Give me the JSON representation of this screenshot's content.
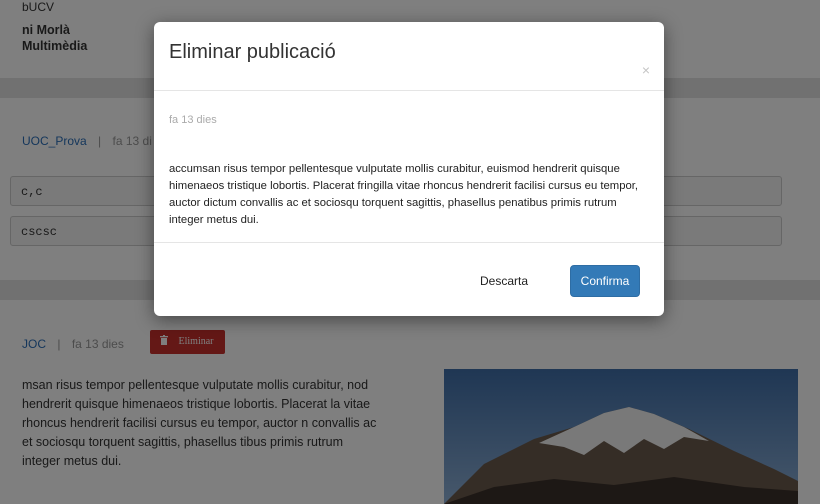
{
  "background": {
    "top_fragment": "bUCV",
    "author_name": "ni Morlà",
    "author_subtitle": "Multimèdia",
    "post1": {
      "author": "UOC_Prova",
      "separator": "|",
      "time": "fa 13 di"
    },
    "comments": [
      "c,c",
      "cscsc"
    ],
    "post2": {
      "author": "JOC",
      "separator": "|",
      "time": "fa 13 dies",
      "delete_label": "Eliminar",
      "body": "msan risus tempor pellentesque vulputate mollis curabitur, nod hendrerit quisque himenaeos tristique lobortis. Placerat la vitae rhoncus hendrerit facilisi cursus eu tempor, auctor n convallis ac et sociosqu torquent sagittis, phasellus tibus primis rutrum integer metus dui."
    }
  },
  "modal": {
    "title": "Eliminar publicació",
    "close_symbol": "×",
    "time": "fa 13 dies",
    "text": "accumsan risus tempor pellentesque vulputate mollis curabitur, euismod hendrerit quisque himenaeos tristique lobortis. Placerat fringilla vitae rhoncus hendrerit facilisi cursus eu tempor, auctor dictum convallis ac et sociosqu torquent sagittis, phasellus penatibus primis rutrum integer metus dui.",
    "cancel_label": "Descarta",
    "confirm_label": "Confirma"
  },
  "icons": {
    "delete": "trash-icon",
    "close": "close-icon"
  },
  "colors": {
    "primary": "#337ab7",
    "danger": "#c9302c",
    "link": "#2a6eb8",
    "overlay": "rgba(0,0,0,0.5)"
  }
}
